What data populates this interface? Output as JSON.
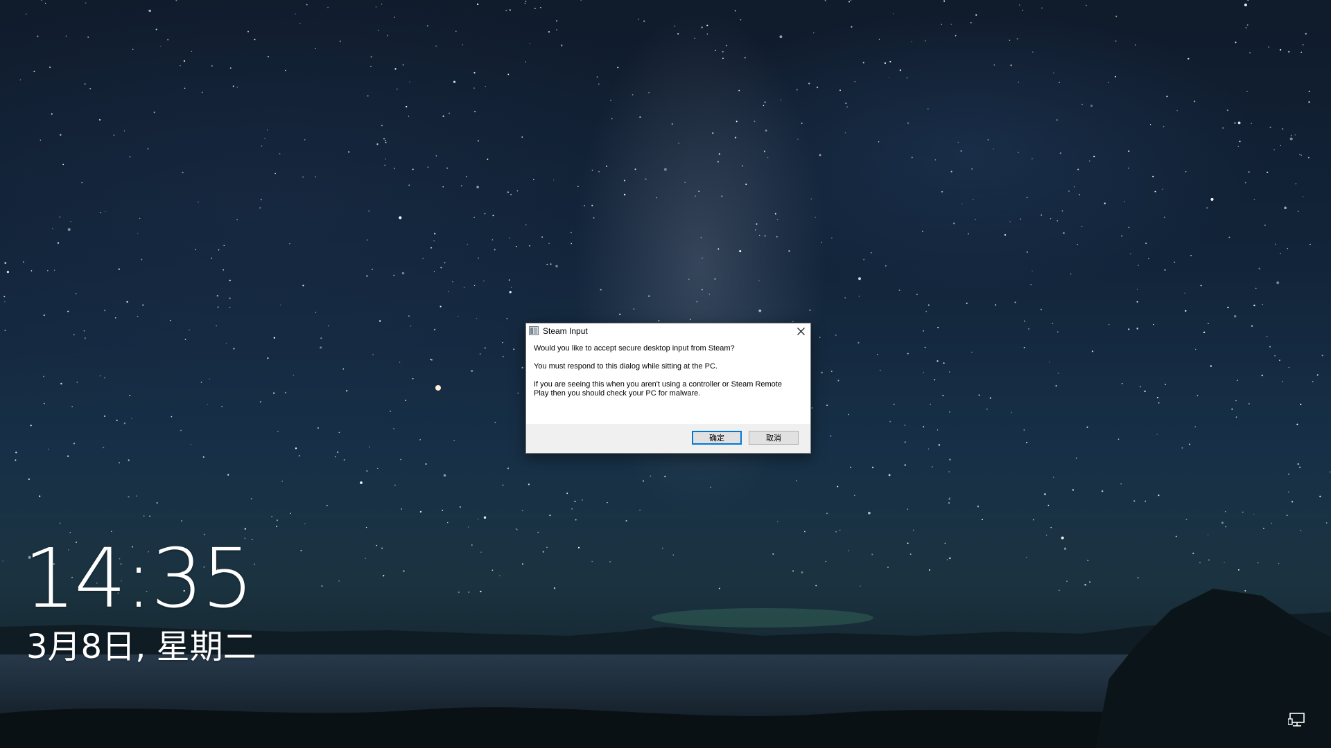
{
  "lock_screen": {
    "time": "14:35",
    "date": "3月8日, 星期二"
  },
  "dialog": {
    "title": "Steam Input",
    "message_1": "Would you like to accept secure desktop input from Steam?",
    "message_2": "You must respond to this dialog while sitting at the PC.",
    "message_3": "If you are seeing this when you aren't using a controller or Steam Remote Play then you should check your PC for malware.",
    "ok_label": "确定",
    "cancel_label": "取消"
  },
  "icons": {
    "app": "steam-app-icon",
    "close": "close-icon",
    "network": "network-icon"
  },
  "colors": {
    "dialog_bg": "#ffffff",
    "button_bar": "#f0f0f0",
    "default_button_border": "#0078d7",
    "text_white": "#ffffff"
  }
}
